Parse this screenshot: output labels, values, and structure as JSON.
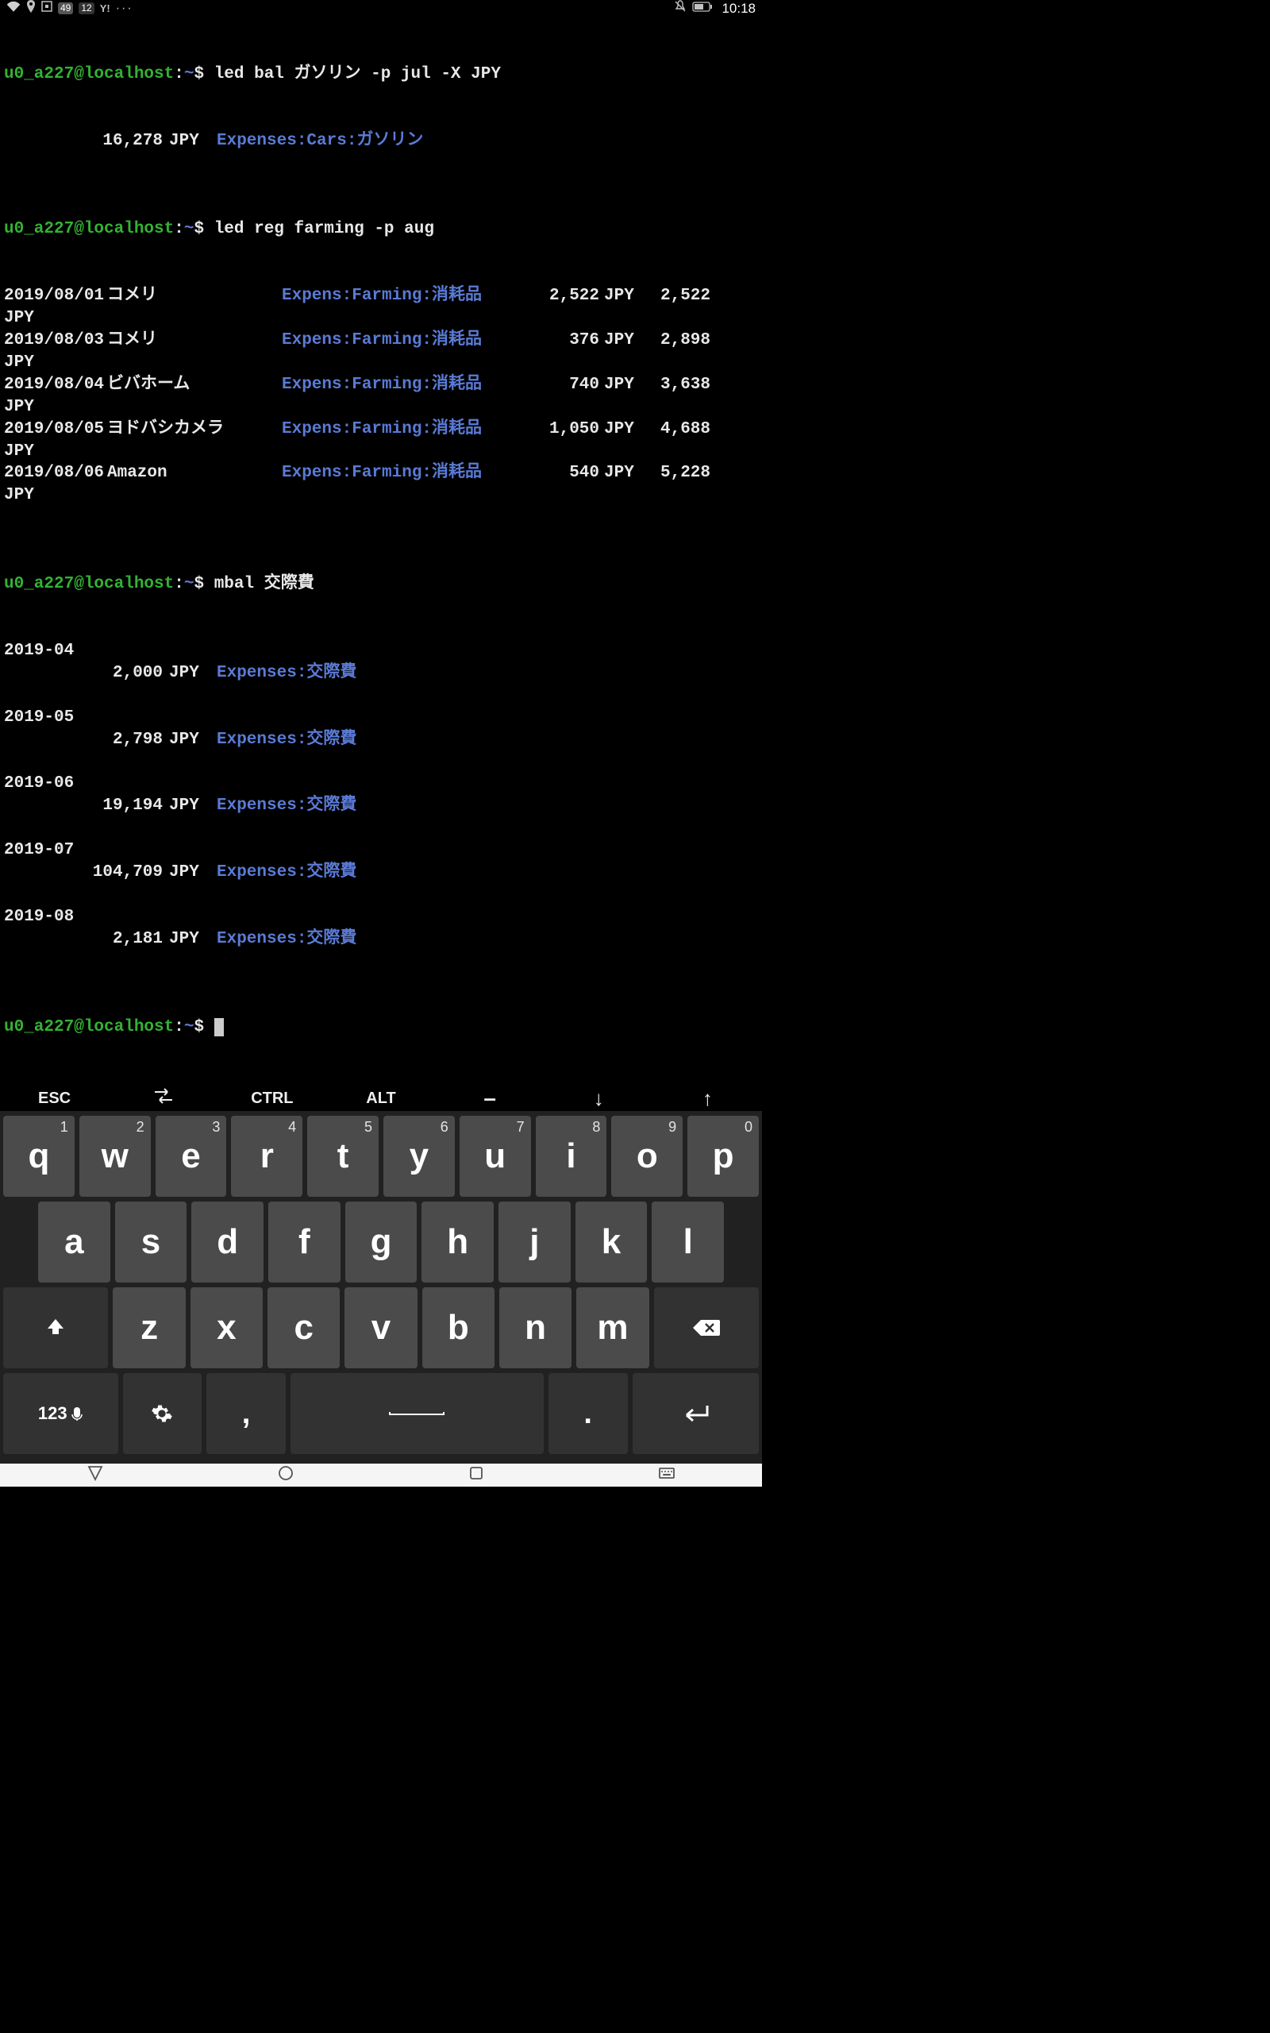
{
  "statusbar": {
    "badge": "49",
    "num": "12",
    "yahoo": "Y!",
    "dots": "···",
    "time": "10:18"
  },
  "prompt": {
    "user": "u0_a227@localhost",
    "sep": ":",
    "path": "~",
    "dollar": "$ "
  },
  "cmd1": "led bal ガソリン -p jul -X JPY",
  "bal1": {
    "amount": "16,278",
    "currency": "JPY",
    "account": "Expenses:Cars:ガソリン"
  },
  "cmd2": "led reg farming -p aug",
  "reg": [
    {
      "date": "2019/08/01",
      "payee": "コメリ",
      "account": "Expens:Farming:消耗品",
      "amount": "2,522",
      "currency": "JPY",
      "running": "2,522",
      "rcur": "JPY"
    },
    {
      "date": "2019/08/03",
      "payee": "コメリ",
      "account": "Expens:Farming:消耗品",
      "amount": "376",
      "currency": "JPY",
      "running": "2,898",
      "rcur": "JPY"
    },
    {
      "date": "2019/08/04",
      "payee": "ビバホーム",
      "account": "Expens:Farming:消耗品",
      "amount": "740",
      "currency": "JPY",
      "running": "3,638",
      "rcur": "JPY"
    },
    {
      "date": "2019/08/05",
      "payee": "ヨドバシカメラ",
      "account": "Expens:Farming:消耗品",
      "amount": "1,050",
      "currency": "JPY",
      "running": "4,688",
      "rcur": "JPY"
    },
    {
      "date": "2019/08/06",
      "payee": "Amazon",
      "account": "Expens:Farming:消耗品",
      "amount": "540",
      "currency": "JPY",
      "running": "5,228",
      "rcur": "JPY"
    }
  ],
  "cmd3": "mbal 交際費",
  "mbal": [
    {
      "period": "2019-04",
      "amount": "2,000",
      "currency": "JPY",
      "account": "Expenses:交際費"
    },
    {
      "period": "2019-05",
      "amount": "2,798",
      "currency": "JPY",
      "account": "Expenses:交際費"
    },
    {
      "period": "2019-06",
      "amount": "19,194",
      "currency": "JPY",
      "account": "Expenses:交際費"
    },
    {
      "period": "2019-07",
      "amount": "104,709",
      "currency": "JPY",
      "account": "Expenses:交際費"
    },
    {
      "period": "2019-08",
      "amount": "2,181",
      "currency": "JPY",
      "account": "Expenses:交際費"
    }
  ],
  "extrakeys": {
    "esc": "ESC",
    "tab": "⇄",
    "ctrl": "CTRL",
    "alt": "ALT",
    "dash": "–",
    "down": "↓",
    "up": "↑"
  },
  "keyboard": {
    "row1": [
      {
        "k": "q",
        "n": "1"
      },
      {
        "k": "w",
        "n": "2"
      },
      {
        "k": "e",
        "n": "3"
      },
      {
        "k": "r",
        "n": "4"
      },
      {
        "k": "t",
        "n": "5"
      },
      {
        "k": "y",
        "n": "6"
      },
      {
        "k": "u",
        "n": "7"
      },
      {
        "k": "i",
        "n": "8"
      },
      {
        "k": "o",
        "n": "9"
      },
      {
        "k": "p",
        "n": "0"
      }
    ],
    "row2": [
      "a",
      "s",
      "d",
      "f",
      "g",
      "h",
      "j",
      "k",
      "l"
    ],
    "row3": {
      "shift": "⇧",
      "letters": [
        "z",
        "x",
        "c",
        "v",
        "b",
        "n",
        "m"
      ],
      "bksp": "⌫"
    },
    "row4": {
      "sym": "123🎤",
      "gear": "⚙",
      "comma": ",",
      "space": " ",
      "period": ".",
      "enter": "↵"
    }
  }
}
